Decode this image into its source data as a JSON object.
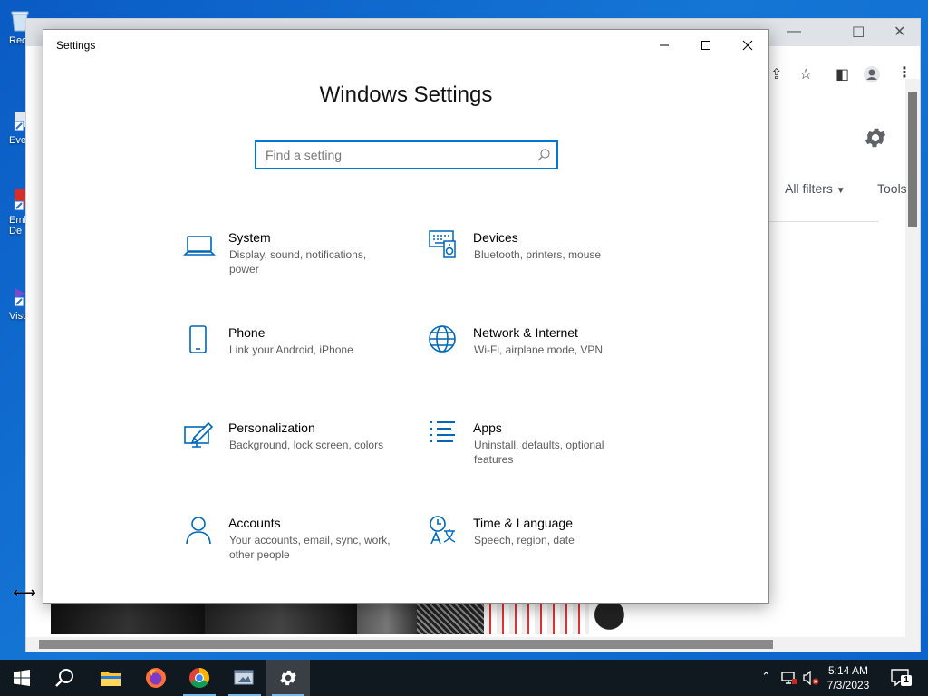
{
  "desktop": {
    "icons": [
      {
        "label": "Rec",
        "name": "recycle-bin"
      },
      {
        "label": "Eve",
        "name": "eve-shortcut"
      },
      {
        "label": "Emb",
        "label2": "De",
        "name": "emb-shortcut"
      },
      {
        "label": "Visu",
        "name": "visual-studio-shortcut"
      }
    ]
  },
  "browser": {
    "filters_label": "All filters",
    "tools_label": "Tools"
  },
  "settings": {
    "window_title": "Settings",
    "heading": "Windows Settings",
    "search_placeholder": "Find a setting",
    "categories": [
      {
        "title": "System",
        "desc": "Display, sound, notifications, power",
        "icon": "laptop-icon"
      },
      {
        "title": "Devices",
        "desc": "Bluetooth, printers, mouse",
        "icon": "keyboard-speaker-icon"
      },
      {
        "title": "Phone",
        "desc": "Link your Android, iPhone",
        "icon": "phone-icon"
      },
      {
        "title": "Network & Internet",
        "desc": "Wi-Fi, airplane mode, VPN",
        "icon": "globe-icon"
      },
      {
        "title": "Personalization",
        "desc": "Background, lock screen, colors",
        "icon": "paint-monitor-icon"
      },
      {
        "title": "Apps",
        "desc": "Uninstall, defaults, optional features",
        "icon": "apps-list-icon"
      },
      {
        "title": "Accounts",
        "desc": "Your accounts, email, sync, work, other people",
        "icon": "person-icon"
      },
      {
        "title": "Time & Language",
        "desc": "Speech, region, date",
        "icon": "time-language-icon"
      }
    ]
  },
  "taskbar": {
    "time": "5:14 AM",
    "date": "7/3/2023",
    "notification_count": "1"
  },
  "colors": {
    "accent": "#0078d4",
    "icon_blue": "#0067b8",
    "taskbar": "#101820"
  }
}
